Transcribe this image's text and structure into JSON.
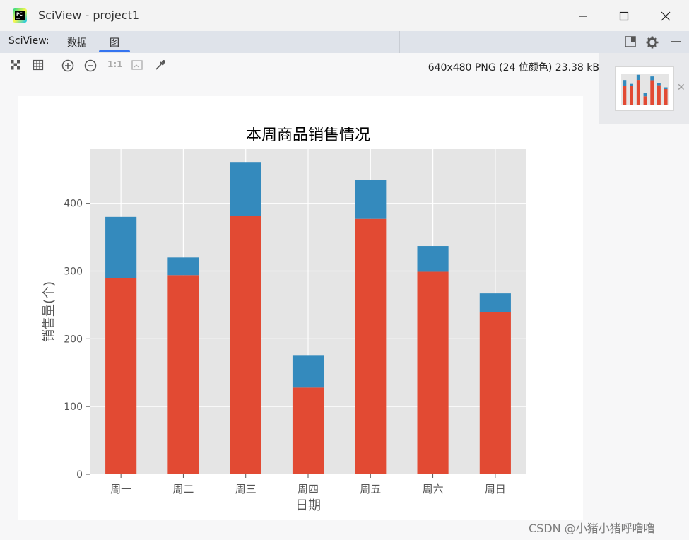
{
  "window": {
    "title": "SciView - project1",
    "app_icon": "pycharm-icon",
    "controls": [
      "minimize-icon",
      "maximize-icon",
      "close-icon"
    ]
  },
  "tabbar": {
    "label": "SciView:",
    "tabs": [
      {
        "label": "数据",
        "active": false
      },
      {
        "label": "图",
        "active": true
      }
    ],
    "right_icons": [
      "panel-toggle-icon",
      "gear-icon",
      "minus-icon"
    ]
  },
  "toolbar": {
    "icons": [
      "chessboard-icon",
      "grid-icon",
      "zoom-in-icon",
      "zoom-out-icon",
      "actual-size-icon",
      "fit-icon",
      "color-picker-icon"
    ],
    "actual_size_label": "1:1",
    "image_info": "640x480 PNG (24 位颜色) 23.38 kB"
  },
  "watermark": "CSDN @小猪小猪呼噜噜",
  "chart_data": {
    "type": "bar",
    "stacked": true,
    "title": "本周商品销售情况",
    "xlabel": "日期",
    "ylabel": "销售量(个)",
    "categories": [
      "周一",
      "周二",
      "周三",
      "周四",
      "周五",
      "周六",
      "周日"
    ],
    "series": [
      {
        "values": [
          290,
          294,
          381,
          128,
          377,
          299,
          240
        ],
        "color": "#e24a33"
      },
      {
        "values": [
          90,
          26,
          80,
          48,
          58,
          38,
          27
        ],
        "color": "#348abd"
      }
    ],
    "ylim": [
      0,
      480
    ],
    "yticks": [
      0,
      100,
      200,
      300,
      400
    ],
    "grid": true,
    "style": "ggplot",
    "plot_bg": "#e5e5e5"
  }
}
